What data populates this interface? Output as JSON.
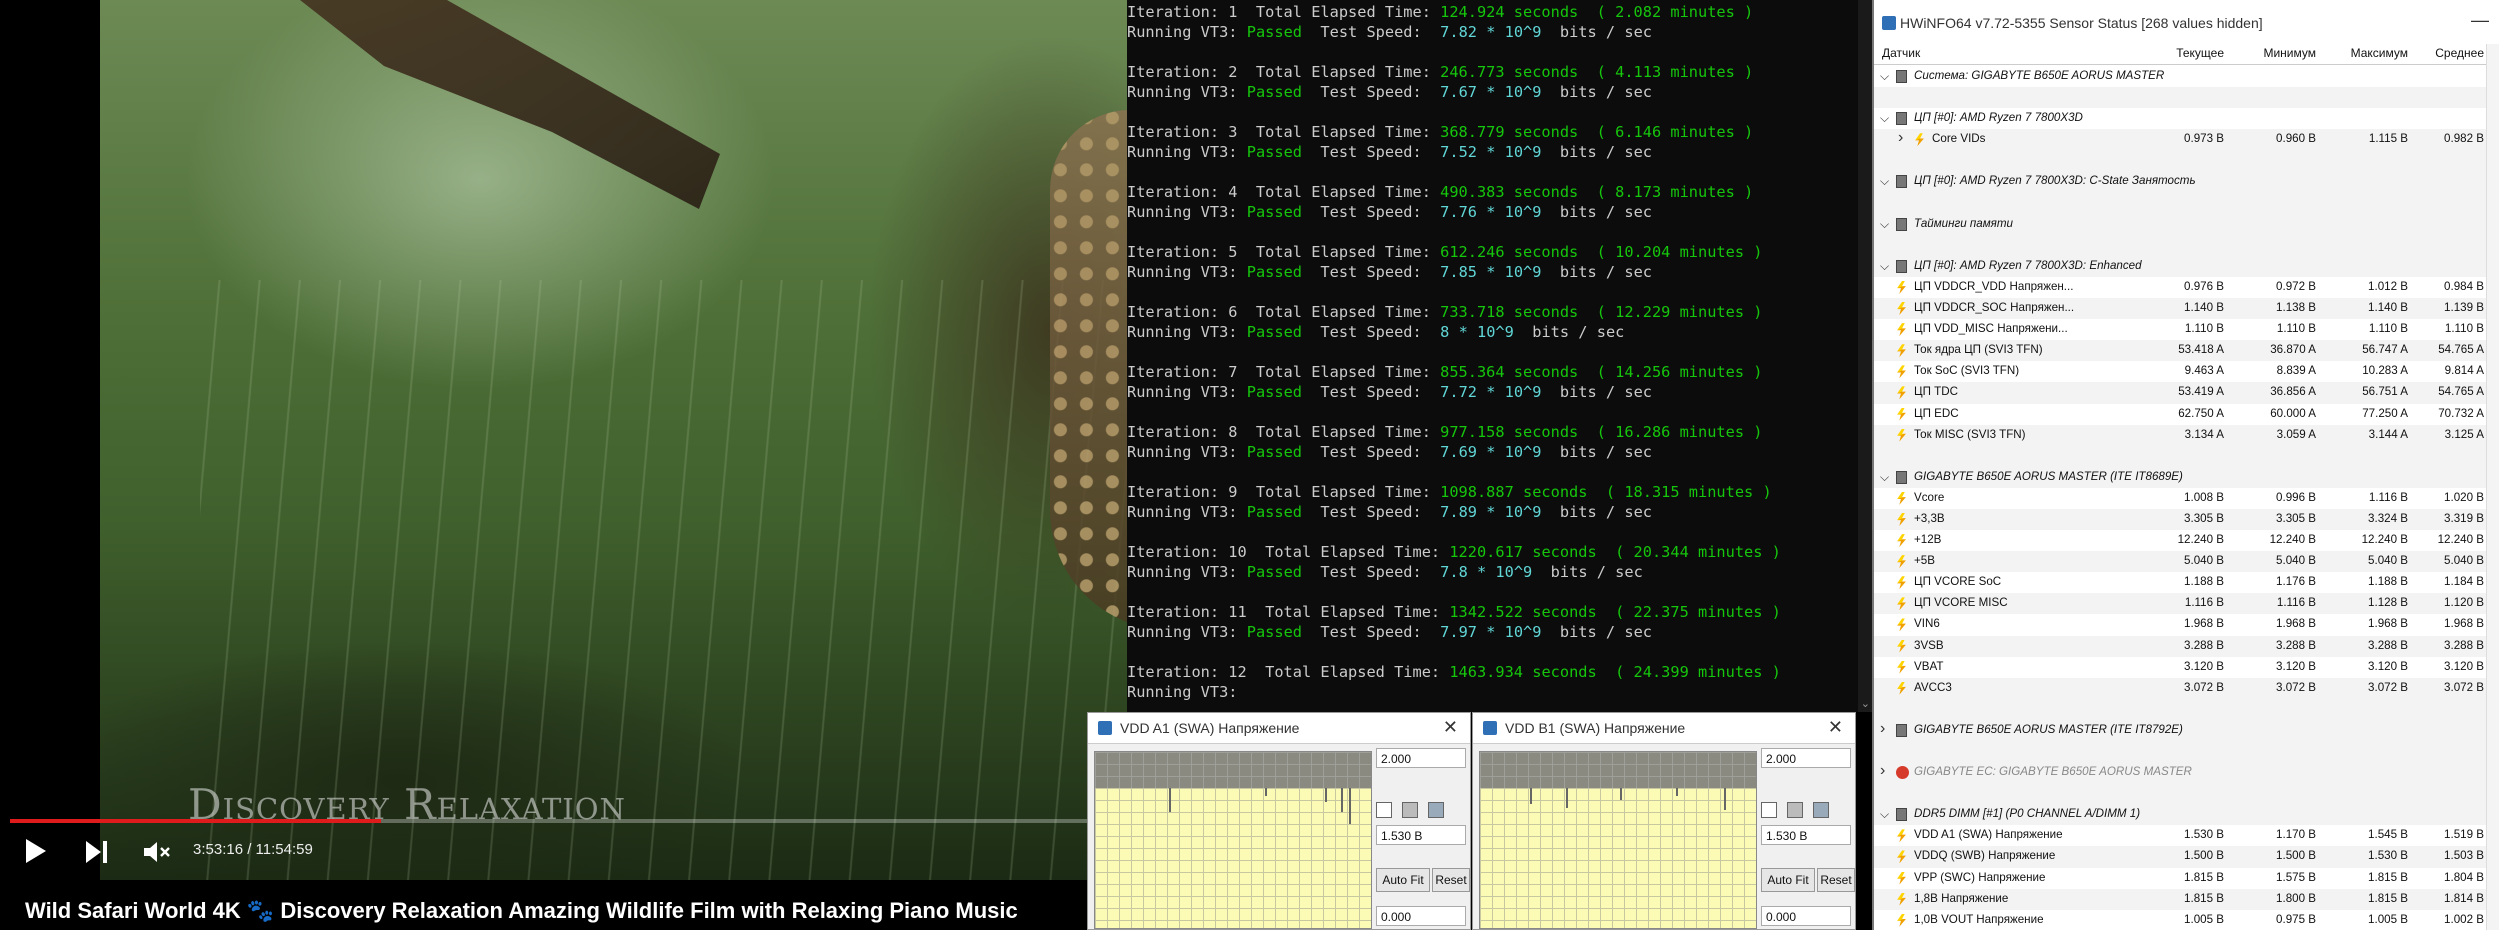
{
  "video": {
    "watermark": "Discovery Relaxation",
    "time": "3:53:16 / 11:54:59",
    "progress_fraction": 0.3354,
    "title": "Wild Safari World 4K 🐾 Discovery Relaxation Amazing Wildlife Film with Relaxing Piano Music",
    "controls": {
      "play_icon": "play-icon",
      "next_icon": "next-icon",
      "mute_icon": "mute-icon"
    }
  },
  "terminal": {
    "iterations": [
      {
        "n": "1",
        "seconds": "124.924",
        "minutes": "2.082",
        "result": "Passed",
        "speed": "7.82 * 10^9"
      },
      {
        "n": "2",
        "seconds": "246.773",
        "minutes": "4.113",
        "result": "Passed",
        "speed": "7.67 * 10^9"
      },
      {
        "n": "3",
        "seconds": "368.779",
        "minutes": "6.146",
        "result": "Passed",
        "speed": "7.52 * 10^9"
      },
      {
        "n": "4",
        "seconds": "490.383",
        "minutes": "8.173",
        "result": "Passed",
        "speed": "7.76 * 10^9"
      },
      {
        "n": "5",
        "seconds": "612.246",
        "minutes": "10.204",
        "result": "Passed",
        "speed": "7.85 * 10^9"
      },
      {
        "n": "6",
        "seconds": "733.718",
        "minutes": "12.229",
        "result": "Passed",
        "speed": "8 * 10^9"
      },
      {
        "n": "7",
        "seconds": "855.364",
        "minutes": "14.256",
        "result": "Passed",
        "speed": "7.72 * 10^9"
      },
      {
        "n": "8",
        "seconds": "977.158",
        "minutes": "16.286",
        "result": "Passed",
        "speed": "7.69 * 10^9"
      },
      {
        "n": "9",
        "seconds": "1098.887",
        "minutes": "18.315",
        "result": "Passed",
        "speed": "7.89 * 10^9"
      },
      {
        "n": "10",
        "seconds": "1220.617",
        "minutes": "20.344",
        "result": "Passed",
        "speed": "7.8 * 10^9"
      },
      {
        "n": "11",
        "seconds": "1342.522",
        "minutes": "22.375",
        "result": "Passed",
        "speed": "7.97 * 10^9"
      },
      {
        "n": "12",
        "seconds": "1463.934",
        "minutes": "24.399",
        "result": "",
        "speed": ""
      }
    ],
    "labels": {
      "iteration": "Iteration:",
      "elapsed": "Total Elapsed Time:",
      "seconds_unit": "seconds",
      "minutes_unit": "minutes",
      "running": "Running VT3:",
      "test_speed": "Test Speed:",
      "speed_unit": "bits / sec"
    },
    "colors": {
      "passed": "#16c60c",
      "value": "#61d6d6",
      "text": "#cccccc",
      "background": "#0c0c0c"
    }
  },
  "graphs": [
    {
      "title": "VDD A1 (SWA) Напряжение",
      "max": "2.000",
      "current": "1.530 В",
      "min": "0.000",
      "autofit": "Auto Fit",
      "reset": "Reset",
      "icon": "hwinfo-graph-icon",
      "close_icon": "close-icon"
    },
    {
      "title": "VDD B1 (SWA) Напряжение",
      "max": "2.000",
      "current": "1.530 В",
      "min": "0.000",
      "autofit": "Auto Fit",
      "reset": "Reset",
      "icon": "hwinfo-graph-icon",
      "close_icon": "close-icon"
    }
  ],
  "hwinfo": {
    "title": "HWiNFO64 v7.72-5355 Sensor Status [268 values hidden]",
    "columns": [
      "Датчик",
      "Текущее",
      "Минимум",
      "Максимум",
      "Среднее"
    ],
    "rows": [
      {
        "kind": "group",
        "expanded": true,
        "icon": "chip",
        "name": "Система: GIGABYTE B650E AORUS MASTER"
      },
      {
        "kind": "blank"
      },
      {
        "kind": "group",
        "expanded": true,
        "icon": "chip",
        "name": "ЦП [#0]: AMD Ryzen 7 7800X3D"
      },
      {
        "kind": "item",
        "sub": true,
        "collapsed": true,
        "icon": "bolt",
        "name": "Core VIDs",
        "cur": "0.973 В",
        "min": "0.960 В",
        "max": "1.115 В",
        "avg": "0.982 В"
      },
      {
        "kind": "blank"
      },
      {
        "kind": "group",
        "expanded": true,
        "icon": "chip",
        "name": "ЦП [#0]: AMD Ryzen 7 7800X3D: C-State Занятость"
      },
      {
        "kind": "blank"
      },
      {
        "kind": "group",
        "expanded": true,
        "icon": "chip",
        "name": "Тайминги памяти"
      },
      {
        "kind": "blank"
      },
      {
        "kind": "group",
        "expanded": true,
        "icon": "chip",
        "name": "ЦП [#0]: AMD Ryzen 7 7800X3D: Enhanced"
      },
      {
        "kind": "item",
        "icon": "bolt",
        "name": "ЦП VDDCR_VDD Напряжен...",
        "cur": "0.976 В",
        "min": "0.972 В",
        "max": "1.012 В",
        "avg": "0.984 В"
      },
      {
        "kind": "item",
        "icon": "bolt",
        "name": "ЦП VDDCR_SOC Напряжен...",
        "cur": "1.140 В",
        "min": "1.138 В",
        "max": "1.140 В",
        "avg": "1.139 В"
      },
      {
        "kind": "item",
        "icon": "bolt",
        "name": "ЦП VDD_MISC Напряжени...",
        "cur": "1.110 В",
        "min": "1.110 В",
        "max": "1.110 В",
        "avg": "1.110 В"
      },
      {
        "kind": "item",
        "icon": "bolt",
        "name": "Ток ядра ЦП (SVI3 TFN)",
        "cur": "53.418 A",
        "min": "36.870 A",
        "max": "56.747 A",
        "avg": "54.765 A"
      },
      {
        "kind": "item",
        "icon": "bolt",
        "name": "Ток SoC (SVI3 TFN)",
        "cur": "9.463 A",
        "min": "8.839 A",
        "max": "10.283 A",
        "avg": "9.814 A"
      },
      {
        "kind": "item",
        "icon": "bolt",
        "name": "ЦП TDC",
        "cur": "53.419 A",
        "min": "36.856 A",
        "max": "56.751 A",
        "avg": "54.765 A"
      },
      {
        "kind": "item",
        "icon": "bolt",
        "name": "ЦП EDC",
        "cur": "62.750 A",
        "min": "60.000 A",
        "max": "77.250 A",
        "avg": "70.732 A"
      },
      {
        "kind": "item",
        "icon": "bolt",
        "name": "Ток MISC (SVI3 TFN)",
        "cur": "3.134 A",
        "min": "3.059 A",
        "max": "3.144 A",
        "avg": "3.125 A"
      },
      {
        "kind": "blank"
      },
      {
        "kind": "group",
        "expanded": true,
        "icon": "chip",
        "name": "GIGABYTE B650E AORUS MASTER (ITE IT8689E)"
      },
      {
        "kind": "item",
        "icon": "bolt",
        "name": "Vcore",
        "cur": "1.008 В",
        "min": "0.996 В",
        "max": "1.116 В",
        "avg": "1.020 В"
      },
      {
        "kind": "item",
        "icon": "bolt",
        "name": "+3,3В",
        "cur": "3.305 В",
        "min": "3.305 В",
        "max": "3.324 В",
        "avg": "3.319 В"
      },
      {
        "kind": "item",
        "icon": "bolt",
        "name": "+12В",
        "cur": "12.240 В",
        "min": "12.240 В",
        "max": "12.240 В",
        "avg": "12.240 В"
      },
      {
        "kind": "item",
        "icon": "bolt",
        "name": "+5В",
        "cur": "5.040 В",
        "min": "5.040 В",
        "max": "5.040 В",
        "avg": "5.040 В"
      },
      {
        "kind": "item",
        "icon": "bolt",
        "name": "ЦП VCORE SoC",
        "cur": "1.188 В",
        "min": "1.176 В",
        "max": "1.188 В",
        "avg": "1.184 В"
      },
      {
        "kind": "item",
        "icon": "bolt",
        "name": "ЦП VCORE MISC",
        "cur": "1.116 В",
        "min": "1.116 В",
        "max": "1.128 В",
        "avg": "1.120 В"
      },
      {
        "kind": "item",
        "icon": "bolt",
        "name": "VIN6",
        "cur": "1.968 В",
        "min": "1.968 В",
        "max": "1.968 В",
        "avg": "1.968 В"
      },
      {
        "kind": "item",
        "icon": "bolt",
        "name": "3VSB",
        "cur": "3.288 В",
        "min": "3.288 В",
        "max": "3.288 В",
        "avg": "3.288 В"
      },
      {
        "kind": "item",
        "icon": "bolt",
        "name": "VBAT",
        "cur": "3.120 В",
        "min": "3.120 В",
        "max": "3.120 В",
        "avg": "3.120 В"
      },
      {
        "kind": "item",
        "icon": "bolt",
        "name": "AVCC3",
        "cur": "3.072 В",
        "min": "3.072 В",
        "max": "3.072 В",
        "avg": "3.072 В"
      },
      {
        "kind": "blank"
      },
      {
        "kind": "group",
        "expanded": false,
        "icon": "chip",
        "name": "GIGABYTE B650E AORUS MASTER (ITE IT8792E)"
      },
      {
        "kind": "blank"
      },
      {
        "kind": "group",
        "expanded": false,
        "icon": "err",
        "dim": true,
        "name": "GIGABYTE EC: GIGABYTE B650E AORUS MASTER"
      },
      {
        "kind": "blank"
      },
      {
        "kind": "group",
        "expanded": true,
        "icon": "chip",
        "name": "DDR5 DIMM [#1] (P0 CHANNEL A/DIMM 1)"
      },
      {
        "kind": "item",
        "icon": "bolt",
        "name": "VDD A1 (SWA) Напряжение",
        "cur": "1.530 В",
        "min": "1.170 В",
        "max": "1.545 В",
        "avg": "1.519 В"
      },
      {
        "kind": "item",
        "icon": "bolt",
        "name": "VDDQ (SWB) Напряжение",
        "cur": "1.500 В",
        "min": "1.500 В",
        "max": "1.530 В",
        "avg": "1.503 В"
      },
      {
        "kind": "item",
        "icon": "bolt",
        "name": "VPP (SWC) Напряжение",
        "cur": "1.815 В",
        "min": "1.575 В",
        "max": "1.815 В",
        "avg": "1.804 В"
      },
      {
        "kind": "item",
        "icon": "bolt",
        "name": "1,8В Напряжение",
        "cur": "1.815 В",
        "min": "1.800 В",
        "max": "1.815 В",
        "avg": "1.814 В"
      },
      {
        "kind": "item",
        "icon": "bolt",
        "name": "1,0В VOUT Напряжение",
        "cur": "1.005 В",
        "min": "0.975 В",
        "max": "1.005 В",
        "avg": "1.002 В"
      }
    ]
  }
}
